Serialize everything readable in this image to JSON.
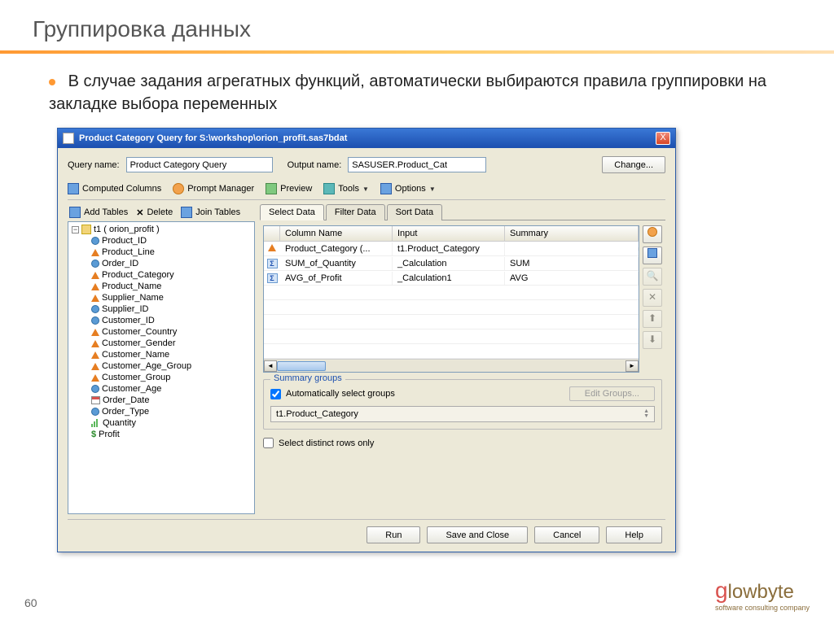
{
  "slide": {
    "title": "Группировка данных",
    "bullet": "В случае задания агрегатных функций, автоматически выбираются правила группировки на закладке выбора переменных",
    "page_num": "60",
    "logo_main": "lowbyte",
    "logo_accent": "g",
    "logo_tagline": "software consulting company"
  },
  "window": {
    "title": "Product Category Query for S:\\workshop\\orion_profit.sas7bdat",
    "close": "X"
  },
  "form": {
    "query_label": "Query name:",
    "query_value": "Product Category Query",
    "output_label": "Output name:",
    "output_value": "SASUSER.Product_Cat",
    "change_btn": "Change..."
  },
  "toolbar": {
    "computed": "Computed Columns",
    "prompt": "Prompt Manager",
    "preview": "Preview",
    "tools": "Tools",
    "options": "Options"
  },
  "left_tb": {
    "add_tables": "Add Tables",
    "delete": "Delete",
    "join_tables": "Join Tables"
  },
  "tree": {
    "root": "t1 ( orion_profit )",
    "items": [
      {
        "icon": "circ",
        "label": "Product_ID"
      },
      {
        "icon": "tri",
        "label": "Product_Line"
      },
      {
        "icon": "circ",
        "label": "Order_ID"
      },
      {
        "icon": "tri",
        "label": "Product_Category"
      },
      {
        "icon": "tri",
        "label": "Product_Name"
      },
      {
        "icon": "tri",
        "label": "Supplier_Name"
      },
      {
        "icon": "circ",
        "label": "Supplier_ID"
      },
      {
        "icon": "circ",
        "label": "Customer_ID"
      },
      {
        "icon": "tri",
        "label": "Customer_Country"
      },
      {
        "icon": "tri",
        "label": "Customer_Gender"
      },
      {
        "icon": "tri",
        "label": "Customer_Name"
      },
      {
        "icon": "tri",
        "label": "Customer_Age_Group"
      },
      {
        "icon": "tri",
        "label": "Customer_Group"
      },
      {
        "icon": "circ",
        "label": "Customer_Age"
      },
      {
        "icon": "cal",
        "label": "Order_Date"
      },
      {
        "icon": "circ",
        "label": "Order_Type"
      },
      {
        "icon": "bar",
        "label": "Quantity"
      },
      {
        "icon": "dollar",
        "label": "Profit"
      }
    ]
  },
  "tabs": {
    "select": "Select Data",
    "filter": "Filter Data",
    "sort": "Sort Data"
  },
  "grid": {
    "headers": {
      "col": "Column Name",
      "inp": "Input",
      "sum": "Summary"
    },
    "rows": [
      {
        "icon": "tri",
        "col": "Product_Category (...",
        "inp": "t1.Product_Category",
        "sum": ""
      },
      {
        "icon": "sigma",
        "col": "SUM_of_Quantity",
        "inp": "_Calculation",
        "sum": "SUM"
      },
      {
        "icon": "sigma",
        "col": "AVG_of_Profit",
        "inp": "_Calculation1",
        "sum": "AVG"
      }
    ]
  },
  "summary": {
    "title": "Summary groups",
    "auto": "Automatically select groups",
    "edit": "Edit Groups...",
    "item": "t1.Product_Category"
  },
  "distinct": "Select distinct rows only",
  "buttons": {
    "run": "Run",
    "save": "Save and Close",
    "cancel": "Cancel",
    "help": "Help"
  }
}
